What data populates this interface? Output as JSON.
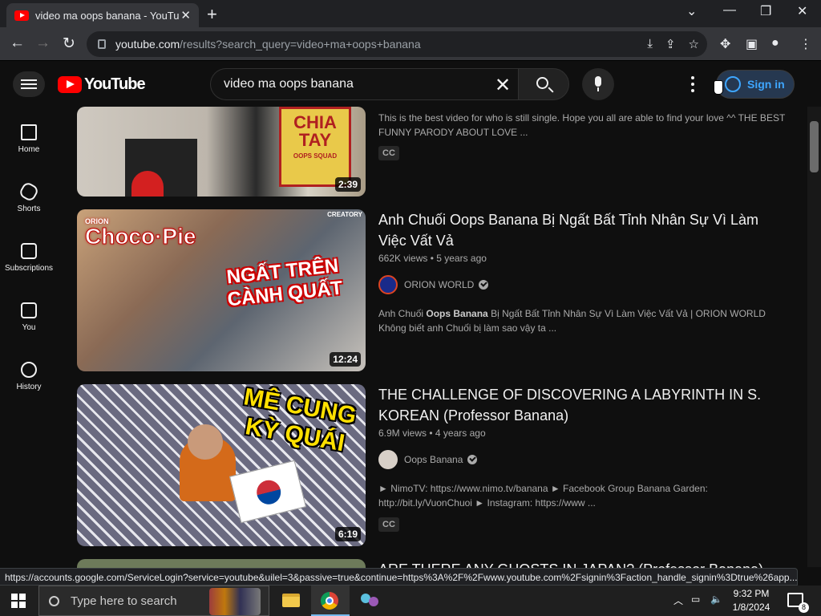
{
  "browser": {
    "tab_title": "video ma oops banana - YouTube",
    "url_domain": "youtube.com",
    "url_path": "/results?search_query=video+ma+oops+banana",
    "status_url": "https://accounts.google.com/ServiceLogin?service=youtube&uilel=3&passive=true&continue=https%3A%2F%2Fwww.youtube.com%2Fsignin%3Faction_handle_signin%3Dtrue%26app..."
  },
  "header": {
    "logo_text": "YouTube",
    "search_value": "video ma oops banana",
    "signin_label": "Sign in"
  },
  "sidebar": {
    "items": [
      {
        "label": "Home",
        "icon": "home-icon"
      },
      {
        "label": "Shorts",
        "icon": "shorts-icon"
      },
      {
        "label": "Subscriptions",
        "icon": "subscriptions-icon"
      },
      {
        "label": "You",
        "icon": "you-icon"
      },
      {
        "label": "History",
        "icon": "history-icon"
      }
    ]
  },
  "results": [
    {
      "thumb_text": "CHIA TAY",
      "thumb_subtext": "OOPS SQUAD",
      "duration": "2:39",
      "description": "This is the best video for who is still single. Hope you all are able to find your love ^^ THE BEST FUNNY PARODY ABOUT LOVE ...",
      "badge": "CC"
    },
    {
      "title": "Anh Chuối Oops Banana Bị Ngất Bất Tỉnh Nhân Sự Vì Làm Việc Vất Vả",
      "views": "662K views",
      "age": "5 years ago",
      "channel": "ORION WORLD",
      "thumb_brand": "Choco·Pie",
      "thumb_brand_small": "ORION",
      "thumb_corner": "CREATORY",
      "thumb_text": "NGẤT TRÊN CÀNH QUẤT",
      "duration": "12:24",
      "description_pre": "Anh Chuối ",
      "description_bold": "Oops Banana",
      "description_post": " Bị Ngất Bất Tỉnh Nhân Sự Vì Làm Việc Vất Vả | ORION WORLD Không biết anh Chuối bị làm sao vậy ta ..."
    },
    {
      "title": "THE CHALLENGE OF DISCOVERING A LABYRINTH IN S. KOREAN (Professor Banana)",
      "views": "6.9M views",
      "age": "4 years ago",
      "channel": "Oops Banana",
      "thumb_text": "MÊ CUNG KỲ QUÁI",
      "duration": "6:19",
      "description": "► NimoTV: https://www.nimo.tv/banana ► Facebook Group Banana Garden: http://bit.ly/VuonChuoi ► Instagram: https://www ...",
      "badge": "CC"
    },
    {
      "title": "ARE THERE ANY GHOSTS IN JAPAN? (Professor Banana)"
    }
  ],
  "taskbar": {
    "search_placeholder": "Type here to search",
    "time": "9:32 PM",
    "date": "1/8/2024",
    "notification_count": "8"
  },
  "colors": {
    "yt_red": "#ff0000",
    "link_blue": "#3ea6ff",
    "page_bg": "#0f0f0f"
  }
}
